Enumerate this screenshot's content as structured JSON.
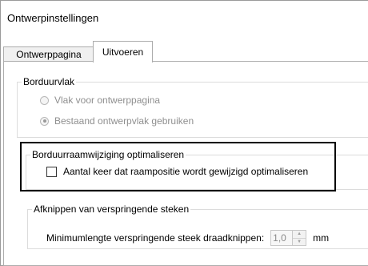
{
  "window": {
    "title": "Ontwerpinstellingen"
  },
  "tabs": [
    {
      "label": "Ontwerppagina"
    },
    {
      "label": "Uitvoeren"
    }
  ],
  "embroidery_area": {
    "legend": "Borduurvlak",
    "options": [
      {
        "label": "Vlak voor ontwerppagina",
        "checked": false,
        "enabled": false
      },
      {
        "label": "Bestaand ontwerpvlak gebruiken",
        "checked": true,
        "enabled": false
      }
    ]
  },
  "hoop_change": {
    "legend": "Borduurraamwijziging optimaliseren",
    "checkbox": {
      "label": "Aantal keer dat raampositie wordt gewijzigd optimaliseren",
      "checked": false
    }
  },
  "jump_trim": {
    "legend": "Afknippen van verspringende steken",
    "min_length_label": "Minimumlengte verspringende steek draadknippen:",
    "min_length_value": "1,0",
    "unit": "mm"
  }
}
